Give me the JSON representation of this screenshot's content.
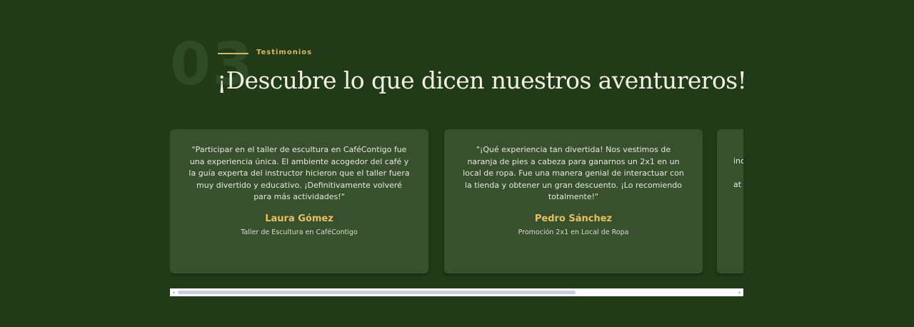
{
  "section": {
    "number": "03",
    "eyebrow": "Testimonios",
    "heading": "¡Descubre lo que dicen nuestros aventureros!"
  },
  "testimonials": [
    {
      "quote": "\"Participar en el taller de escultura en CaféContigo fue una experiencia única. El ambiente acogedor del café y la guía experta del instructor hicieron que el taller fuera muy divertido y educativo. ¡Definitivamente volveré para más actividades!\"",
      "name": "Laura Gómez",
      "role": "Taller de Escultura en CaféContigo"
    },
    {
      "quote": "\"¡Qué experiencia tan divertida! Nos vestimos de naranja de pies a cabeza para ganarnos un 2x1 en un local de ropa. Fue una manera genial de interactuar con la tienda y obtener un gran descuento. ¡Lo recomiendo totalmente!\"",
      "name": "Pedro Sánchez",
      "role": "Promoción 2x1 en Local de Ropa"
    },
    {
      "quote": "inc\n\nat",
      "name": "",
      "role": ""
    }
  ],
  "scrollbar": {
    "left_arrow": "‹",
    "right_arrow": "›",
    "position_fraction": 0.0,
    "visible_fraction": 0.7
  },
  "colors": {
    "background": "#213a18",
    "card": "#38502e",
    "accent": "#d8b862",
    "name": "#e4c060",
    "heading": "#f2efe3"
  }
}
